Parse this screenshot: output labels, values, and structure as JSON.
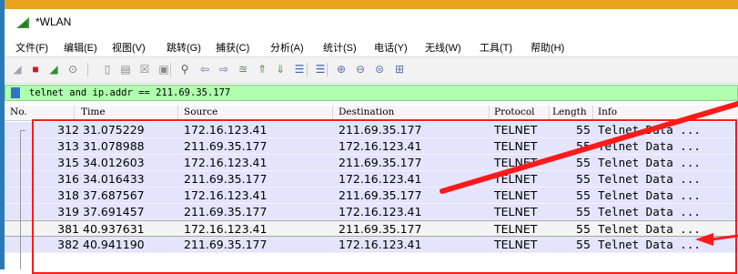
{
  "window": {
    "title": "*WLAN"
  },
  "menu": [
    "文件(F)",
    "编辑(E)",
    "视图(V)",
    "跳转(G)",
    "捕获(C)",
    "分析(A)",
    "统计(S)",
    "电话(Y)",
    "无线(W)",
    "工具(T)",
    "帮助(H)"
  ],
  "filter": {
    "text": "telnet and ip.addr == 211.69.35.177"
  },
  "columns": [
    "No.",
    "Time",
    "Source",
    "Destination",
    "Protocol",
    "Length",
    "Info"
  ],
  "packets": [
    {
      "no": "312",
      "time": "31.075229",
      "src": "172.16.123.41",
      "dst": "211.69.35.177",
      "proto": "TELNET",
      "len": "55",
      "info": "Telnet Data ..."
    },
    {
      "no": "313",
      "time": "31.078988",
      "src": "211.69.35.177",
      "dst": "172.16.123.41",
      "proto": "TELNET",
      "len": "55",
      "info": "Telnet Data ..."
    },
    {
      "no": "315",
      "time": "34.012603",
      "src": "172.16.123.41",
      "dst": "211.69.35.177",
      "proto": "TELNET",
      "len": "55",
      "info": "Telnet Data ..."
    },
    {
      "no": "316",
      "time": "34.016433",
      "src": "211.69.35.177",
      "dst": "172.16.123.41",
      "proto": "TELNET",
      "len": "55",
      "info": "Telnet Data ..."
    },
    {
      "no": "318",
      "time": "37.687567",
      "src": "172.16.123.41",
      "dst": "211.69.35.177",
      "proto": "TELNET",
      "len": "55",
      "info": "Telnet Data ..."
    },
    {
      "no": "319",
      "time": "37.691457",
      "src": "211.69.35.177",
      "dst": "172.16.123.41",
      "proto": "TELNET",
      "len": "55",
      "info": "Telnet Data ..."
    },
    {
      "no": "381",
      "time": "40.937631",
      "src": "172.16.123.41",
      "dst": "211.69.35.177",
      "proto": "TELNET",
      "len": "55",
      "info": "Telnet Data ..."
    },
    {
      "no": "382",
      "time": "40.941190",
      "src": "211.69.35.177",
      "dst": "172.16.123.41",
      "proto": "TELNET",
      "len": "55",
      "info": "Telnet Data ..."
    }
  ],
  "selected_packet": "381",
  "colors": {
    "row_background": "#e4e4fc",
    "selected_row_background": "#f4f4f4",
    "filter_background": "#afffaf",
    "annotation_red": "#ff1a1a",
    "app_icon_green": "#3a9a3a"
  },
  "icons": {
    "app": "wireshark-fin-icon",
    "toolbar": [
      "start-capture-icon",
      "stop-capture-icon",
      "restart-capture-icon",
      "capture-options-icon",
      "open-file-icon",
      "save-file-icon",
      "close-file-icon",
      "reload-file-icon",
      "find-packet-icon",
      "go-back-icon",
      "go-forward-icon",
      "go-to-packet-icon",
      "go-first-icon",
      "go-last-icon",
      "auto-scroll-icon",
      "colorize-icon",
      "zoom-in-icon",
      "zoom-out-icon",
      "normal-size-icon",
      "resize-columns-icon"
    ]
  }
}
